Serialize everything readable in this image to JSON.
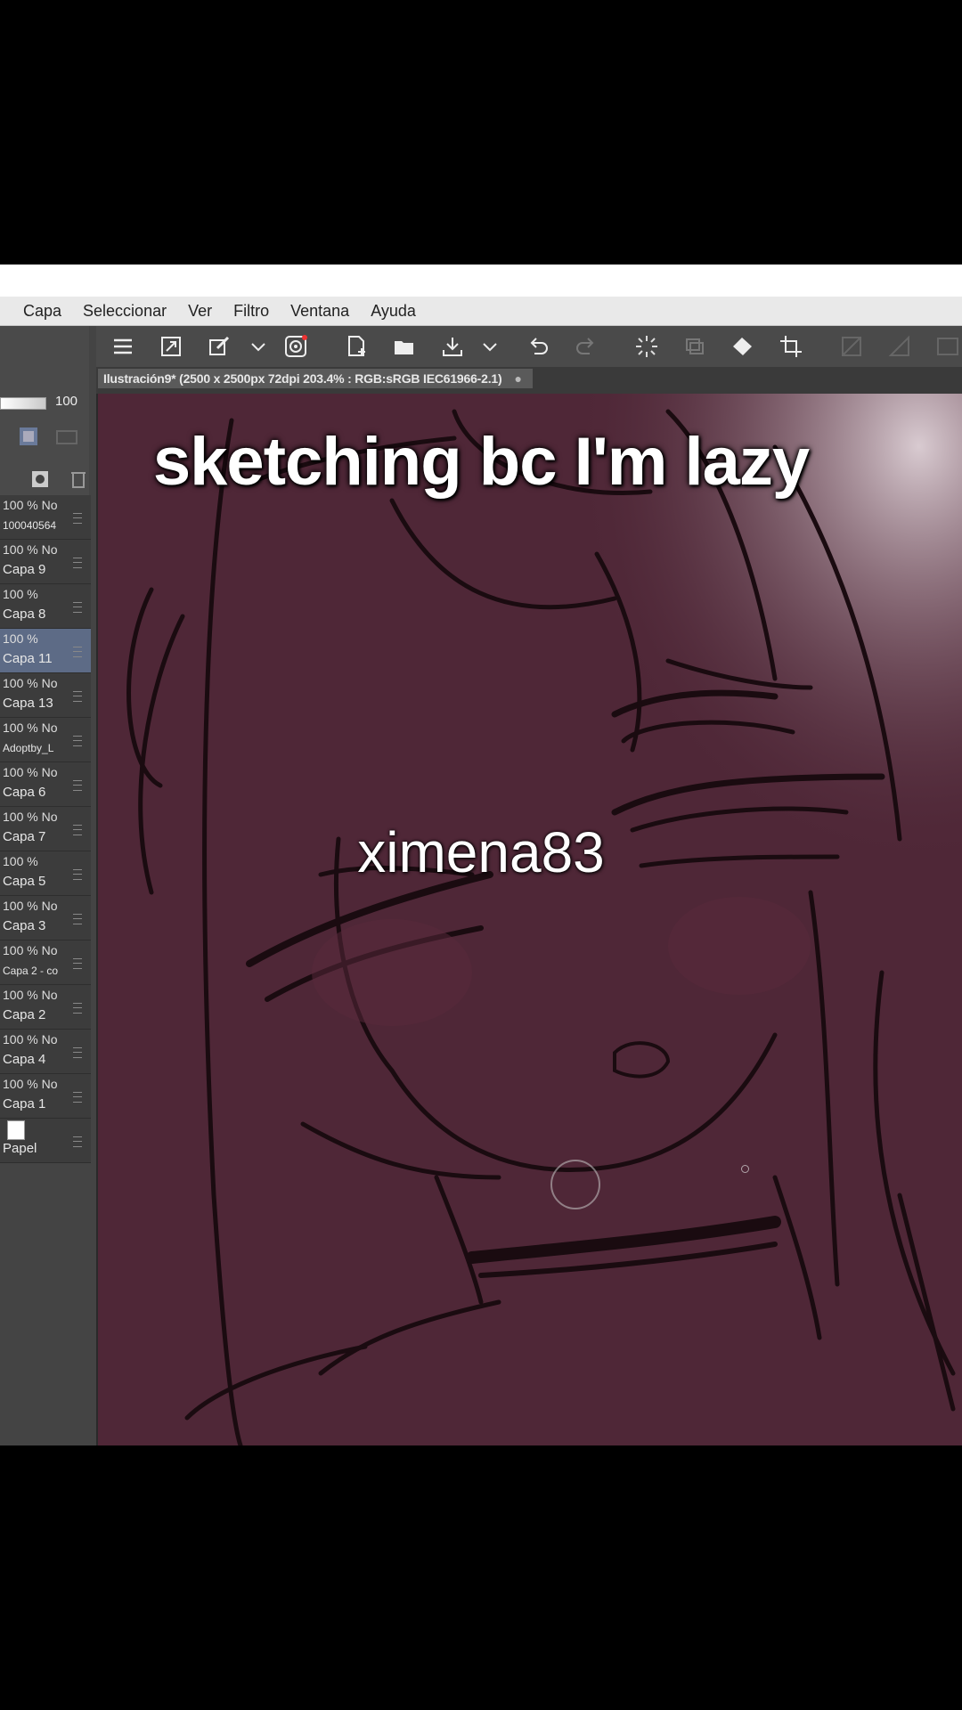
{
  "menu": {
    "items": [
      "Capa",
      "Seleccionar",
      "Ver",
      "Filtro",
      "Ventana",
      "Ayuda"
    ]
  },
  "document_tab": {
    "title": "Ilustración9* (2500 x 2500px 72dpi 203.4% : RGB:sRGB IEC61966-2.1)",
    "close": "●"
  },
  "toolbar": {
    "icons": [
      "menu-icon",
      "fullscreen-icon",
      "brush-settings-icon",
      "chevron-down-icon",
      "swirl-icon",
      "new-file-icon",
      "open-folder-icon",
      "import-icon",
      "chevron-down-icon",
      "undo-icon",
      "redo-icon",
      "loading-icon",
      "layer-icon",
      "fill-icon",
      "crop-icon",
      "transform-icon",
      "ruler-icon",
      "frame-icon"
    ]
  },
  "left_panel": {
    "opacity_value": "100",
    "layers": [
      {
        "pct": "100 % No",
        "name": "100040564"
      },
      {
        "pct": "100 % No",
        "name": "Capa 9"
      },
      {
        "pct": "100 %",
        "name": "Capa 8"
      },
      {
        "pct": "100 %",
        "name": "Capa 11"
      },
      {
        "pct": "100 % No",
        "name": "Capa 13"
      },
      {
        "pct": "100 % No",
        "name": "Adoptby_L"
      },
      {
        "pct": "100 % No",
        "name": "Capa 6"
      },
      {
        "pct": "100 % No",
        "name": "Capa 7"
      },
      {
        "pct": "100 %",
        "name": "Capa 5"
      },
      {
        "pct": "100 % No",
        "name": "Capa 3"
      },
      {
        "pct": "100 % No",
        "name": "Capa 2 - co"
      },
      {
        "pct": "100 % No",
        "name": "Capa 2"
      },
      {
        "pct": "100 % No",
        "name": "Capa 4"
      },
      {
        "pct": "100 % No",
        "name": "Capa 1"
      },
      {
        "pct": "",
        "name": "Papel"
      }
    ]
  },
  "overlay": {
    "caption": "sketching bc I'm lazy",
    "username": "ximena83"
  },
  "colors": {
    "canvas": "#4f2737",
    "panel": "#3c3c3c",
    "selected_layer": "#5d6b86"
  }
}
